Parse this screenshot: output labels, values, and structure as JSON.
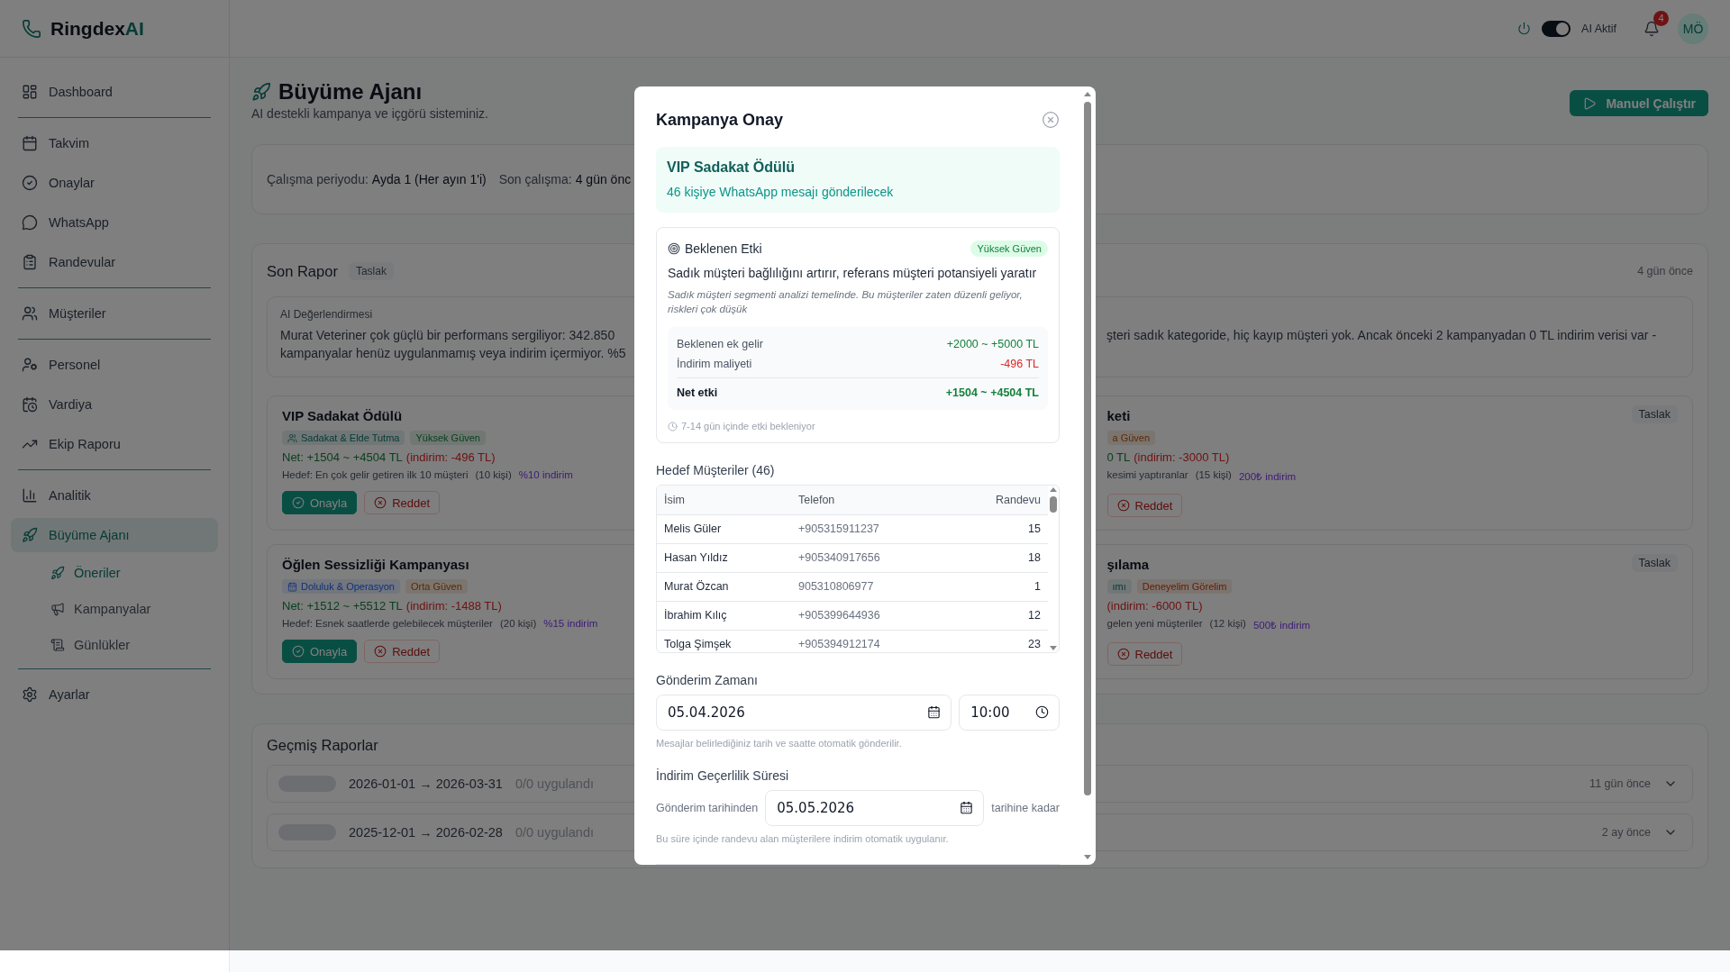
{
  "brand": {
    "name": "Ringdex",
    "accent": "AI"
  },
  "sidebar": {
    "groups": [
      {
        "items": [
          {
            "label": "Dashboard",
            "selected": false
          }
        ]
      },
      {
        "items": [
          {
            "label": "Takvim",
            "selected": false
          },
          {
            "label": "Onaylar",
            "selected": false
          },
          {
            "label": "WhatsApp",
            "selected": false
          },
          {
            "label": "Randevular",
            "selected": false
          }
        ]
      },
      {
        "items": [
          {
            "label": "Müşteriler",
            "selected": false
          }
        ]
      },
      {
        "items": [
          {
            "label": "Personel",
            "selected": false
          },
          {
            "label": "Vardiya",
            "selected": false
          },
          {
            "label": "Ekip Raporu",
            "selected": false
          }
        ]
      },
      {
        "items": [
          {
            "label": "Analitik",
            "selected": false
          },
          {
            "label": "Büyüme Ajanı",
            "selected": true,
            "children": [
              {
                "label": "Öneriler",
                "selected": true
              },
              {
                "label": "Kampanyalar",
                "selected": false
              },
              {
                "label": "Günlükler",
                "selected": false
              }
            ]
          }
        ]
      },
      {
        "items": [
          {
            "label": "Ayarlar",
            "selected": false
          }
        ]
      }
    ]
  },
  "topbar": {
    "ai_toggle": {
      "label": "AI Aktif",
      "on": true
    },
    "notifications": {
      "count": "4"
    },
    "avatar": {
      "initials": "MÖ"
    }
  },
  "page": {
    "title": "Büyüme Ajanı",
    "subtitle": "AI destekli kampanya ve içgörü sisteminiz.",
    "run_button": "Manuel Çalıştır"
  },
  "schedule": [
    {
      "label": "Çalışma periyodu:",
      "value": "Ayda 1 (Her ayın 1'i)"
    },
    {
      "label": "Son çalışma:",
      "value": "4 gün önc"
    }
  ],
  "latest_report": {
    "title": "Son Rapor",
    "status": "Taslak",
    "age": "4 gün önce",
    "ai_assessment": {
      "label": "AI Değerlendirmesi",
      "left_lines": [
        "Murat Veteriner çok güçlü bir performans sergiliyor: 342.850",
        "kampanyalar henüz uygulanmamış veya indirim içermiyor. %5"
      ],
      "right_lines": [
        "şteri sadık kategoride, hiç kayıp müşteri yok. Ancak önceki 2 kampanyadan 0 TL indirim verisi var -"
      ]
    },
    "campaigns": [
      {
        "title": "VIP Sadakat Ödülü",
        "tags": [
          {
            "label": "Sadakat & Elde Tutma",
            "kind": "loyalty"
          },
          {
            "label": "Yüksek Güven",
            "kind": "high"
          }
        ],
        "net": "Net: +1504 ~ +4504 TL",
        "discount": "(indirim: -496 TL)",
        "target": "Hedef: En çok gelir getiren ilk 10 müşteri",
        "count": "(10 kişi)",
        "offer": "%10 indirim",
        "actions": [
          {
            "label": "Onayla",
            "kind": "approve"
          },
          {
            "label": "Reddet",
            "kind": "reject"
          }
        ]
      },
      {
        "title": "keti",
        "status": "Taslak",
        "tags": [
          {
            "label": "a Güven",
            "kind": "medium"
          }
        ],
        "net": "0 TL",
        "discount": "(indirim: -3000 TL)",
        "target": "kesimi yaptıranlar",
        "count": "(15 kişi)",
        "offer": "200₺ indirim",
        "actions": [
          {
            "label": "Reddet",
            "kind": "reject"
          }
        ]
      },
      {
        "title": "Öğlen Sessizliği Kampanyası",
        "tags": [
          {
            "label": "Doluluk & Operasyon",
            "kind": "occupancy"
          },
          {
            "label": "Orta Güven",
            "kind": "medium"
          }
        ],
        "net": "Net: +1512 ~ +5512 TL",
        "discount": "(indirim: -1488 TL)",
        "target": "Hedef: Esnek saatlerde gelebilecek müşteriler",
        "count": "(20 kişi)",
        "offer": "%15 indirim",
        "actions": [
          {
            "label": "Onayla",
            "kind": "approve"
          },
          {
            "label": "Reddet",
            "kind": "reject"
          }
        ]
      },
      {
        "title": "şılama",
        "status": "Taslak",
        "tags": [
          {
            "label": "ımı",
            "kind": "acquisition"
          },
          {
            "label": "Deneyelim Görelim",
            "kind": "trial"
          }
        ],
        "discount": "(indirim: -6000 TL)",
        "target": "gelen yeni müşteriler",
        "count": "(12 kişi)",
        "offer": "500₺ indirim",
        "actions": [
          {
            "label": "Reddet",
            "kind": "reject"
          }
        ]
      }
    ]
  },
  "past_reports": {
    "title": "Geçmiş Raporlar",
    "rows": [
      {
        "range": "2026-01-01 → 2026-03-31",
        "applied": "0/0 uygulandı",
        "age": "11 gün önce"
      },
      {
        "range": "2025-12-01 → 2026-02-28",
        "applied": "0/0 uygulandı",
        "age": "2 ay önce"
      }
    ]
  },
  "modal": {
    "title": "Kampanya Onay",
    "campaign": {
      "title": "VIP Sadakat Ödülü",
      "summary": "46 kişiye WhatsApp mesajı gönderilecek"
    },
    "impact": {
      "title": "Beklenen Etki",
      "confidence": "Yüksek Güven",
      "headline": "Sadık müşteri bağlılığını artırır, referans müşteri potansiyeli yaratır",
      "note": "Sadık müşteri segmenti analizi temelinde. Bu müşteriler zaten düzenli geliyor, riskleri çok düşük",
      "rows": [
        {
          "label": "Beklenen ek gelir",
          "value": "+2000 ~ +5000 TL",
          "kind": "gain"
        },
        {
          "label": "İndirim maliyeti",
          "value": "-496 TL",
          "kind": "cost"
        },
        {
          "label": "Net etki",
          "value": "+1504 ~ +4504 TL",
          "kind": "total"
        }
      ],
      "timing": "7-14 gün içinde etki bekleniyor"
    },
    "targets": {
      "title": "Hedef Müşteriler (46)",
      "columns": [
        "İsim",
        "Telefon",
        "Randevu"
      ],
      "rows": [
        [
          "Melis Güler",
          "+905315911237",
          "15"
        ],
        [
          "Hasan Yıldız",
          "+905340917656",
          "18"
        ],
        [
          "Murat Özcan",
          "905310806977",
          "1"
        ],
        [
          "İbrahim Kılıç",
          "+905399644936",
          "12"
        ],
        [
          "Tolga Şimşek",
          "+905394912174",
          "23"
        ]
      ]
    },
    "send_time": {
      "title": "Gönderim Zamanı",
      "date": "05.04.2026",
      "time": "10:00",
      "hint": "Mesajlar belirlediğiniz tarih ve saatte otomatik gönderilir."
    },
    "validity": {
      "title": "İndirim Geçerlilik Süresi",
      "prefix": "Gönderim tarihinden",
      "date": "05.05.2026",
      "suffix": "tarihine kadar",
      "hint": "Bu süre içinde randevu alan müşterilere indirim otomatik uygulanır."
    }
  }
}
